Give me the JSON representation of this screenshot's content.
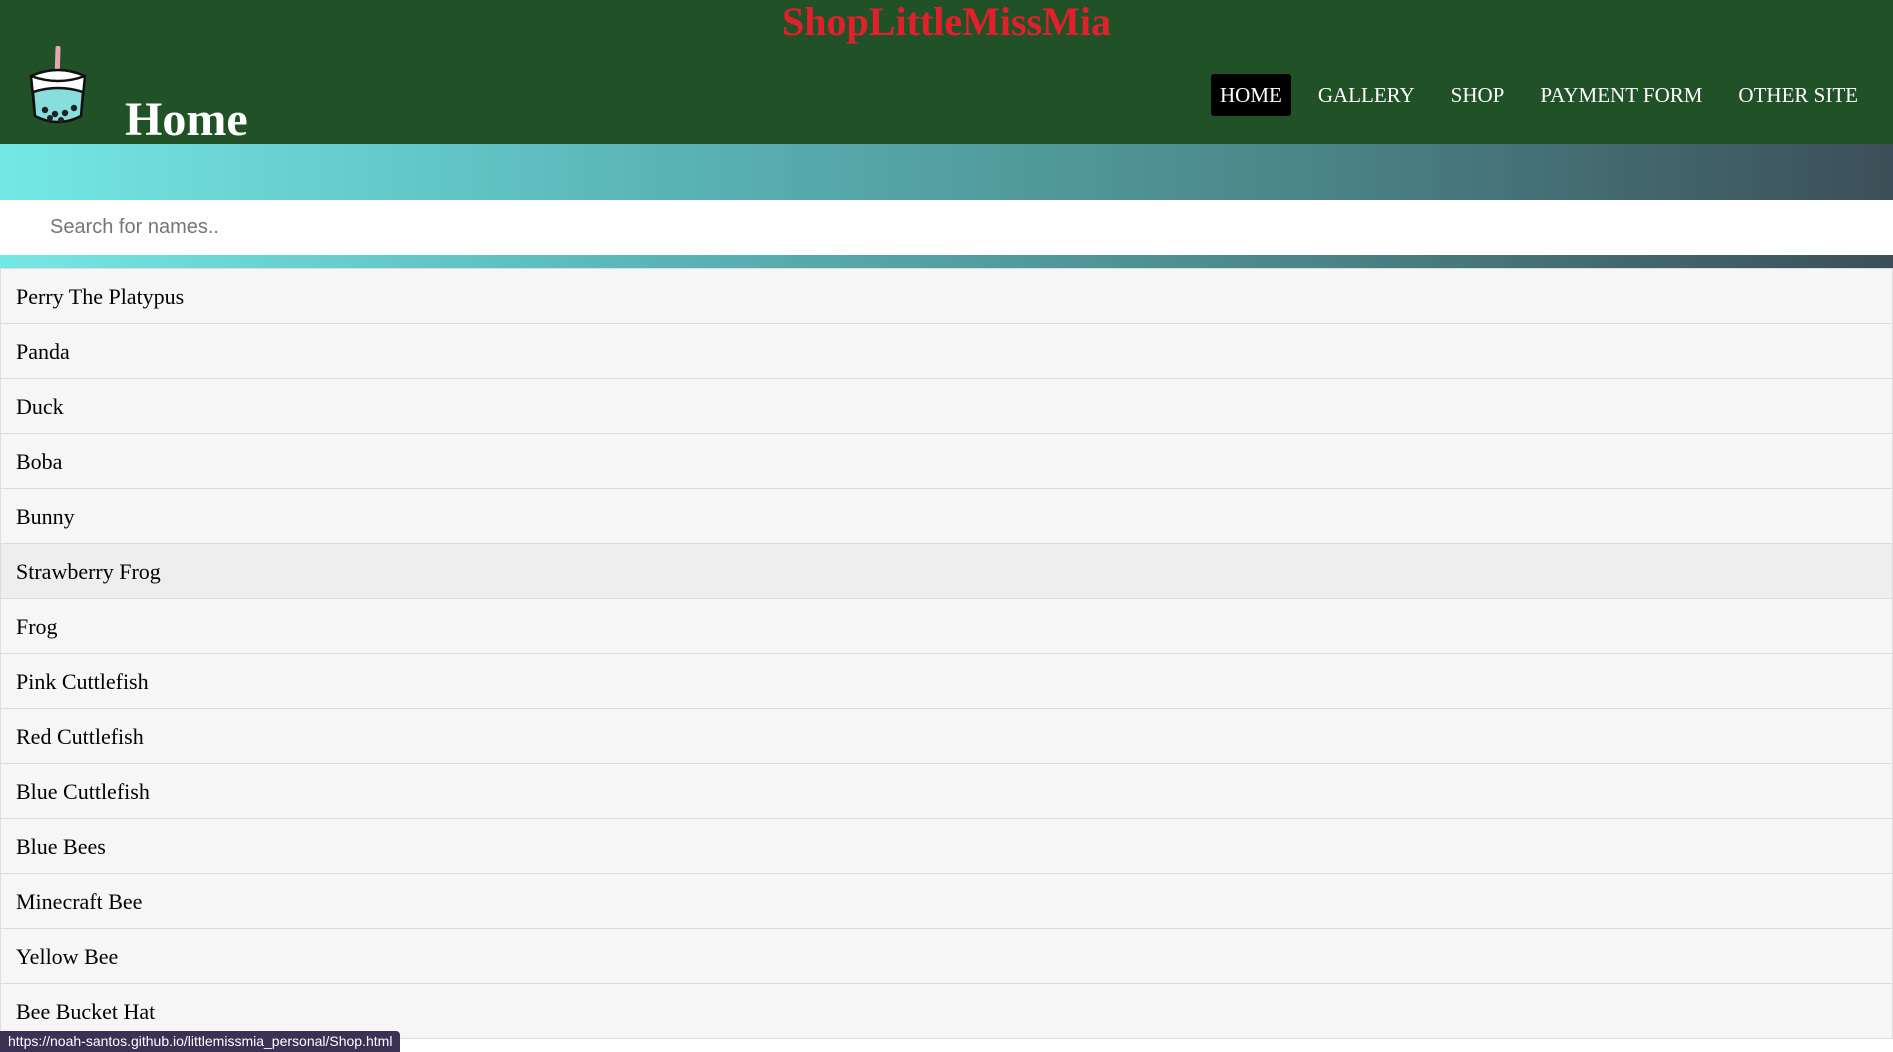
{
  "site": {
    "title": "ShopLittleMissMia"
  },
  "header": {
    "page_title": "Home",
    "logo_icon": "boba-tea-icon"
  },
  "nav": {
    "items": [
      {
        "label": "HOME",
        "active": true
      },
      {
        "label": "GALLERY",
        "active": false
      },
      {
        "label": "SHOP",
        "active": false
      },
      {
        "label": "PAYMENT FORM",
        "active": false
      },
      {
        "label": "OTHER SITE",
        "active": false
      }
    ]
  },
  "search": {
    "placeholder": "Search for names..",
    "value": ""
  },
  "list": {
    "items": [
      "Perry The Platypus",
      "Panda",
      "Duck",
      "Boba",
      "Bunny",
      "Strawberry Frog",
      "Frog",
      "Pink Cuttlefish",
      "Red Cuttlefish",
      "Blue Cuttlefish",
      "Blue Bees",
      "Minecraft Bee",
      "Yellow Bee",
      "Bee Bucket Hat"
    ],
    "hovered": "Strawberry Frog"
  },
  "status_bar": {
    "url": "https://noah-santos.github.io/littlemissmia_personal/Shop.html"
  },
  "colors": {
    "header_bg": "#215227",
    "title_red": "#e2202b",
    "banner_start": "#74e8e4",
    "banner_end": "#3c4f58",
    "list_bg": "#f6f6f6",
    "nav_active_bg": "#000000"
  }
}
